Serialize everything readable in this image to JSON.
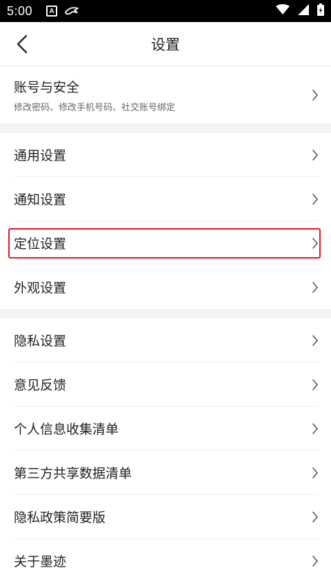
{
  "status": {
    "time": "5:00",
    "notif_letter": "A"
  },
  "header": {
    "title": "设置"
  },
  "group1": {
    "items": [
      {
        "label": "账号与安全",
        "sub": "修改密码、修改手机号码、社交账号绑定"
      }
    ]
  },
  "group2": {
    "items": [
      {
        "label": "通用设置"
      },
      {
        "label": "通知设置"
      },
      {
        "label": "定位设置"
      },
      {
        "label": "外观设置"
      }
    ]
  },
  "group3": {
    "items": [
      {
        "label": "隐私设置"
      },
      {
        "label": "意见反馈"
      },
      {
        "label": "个人信息收集清单"
      },
      {
        "label": "第三方共享数据清单"
      },
      {
        "label": "隐私政策简要版"
      },
      {
        "label": "关于墨迹"
      }
    ]
  },
  "colors": {
    "highlight": "#e8141e",
    "background": "#f4f4f4"
  }
}
